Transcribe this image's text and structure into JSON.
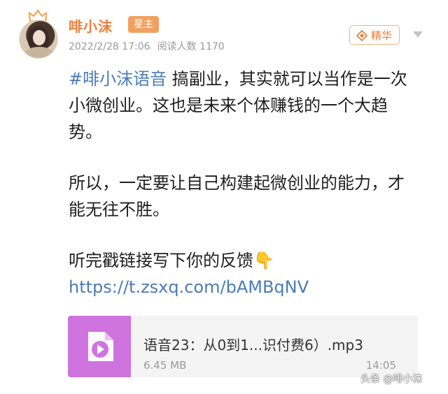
{
  "author": {
    "name": "啡小沫",
    "badge": "星主"
  },
  "meta": {
    "datetime": "2022/2/28 17:06",
    "reads": "阅读人数 1170"
  },
  "featured_label": "精华",
  "post": {
    "hashtag": "#啡小沫语音",
    "line1_rest": " 搞副业，其实就可以当作是一次小微创业。这也是未来个体赚钱的一个大趋势。",
    "para2": "所以，一定要让自己构建起微创业的能力，才能无往不胜。",
    "para3": "听完戳链接写下你的反馈👇",
    "link": "https://t.zsxq.com/bAMBqNV"
  },
  "attachment": {
    "name": "语音23：从0到1...识付费6）.mp3",
    "size": "6.45 MB",
    "duration": "14:05"
  },
  "watermark": "头条 @啡小沫",
  "icons": {
    "crown": "crown-icon",
    "featured": "diamond-icon",
    "more": "chevron-down-icon",
    "attachment": "play-icon"
  },
  "colors": {
    "accent_orange": "#f07d3b",
    "badge_bg": "#f2a060",
    "link_blue": "#4a7bb7",
    "thumb_purple": "#cf73df"
  }
}
